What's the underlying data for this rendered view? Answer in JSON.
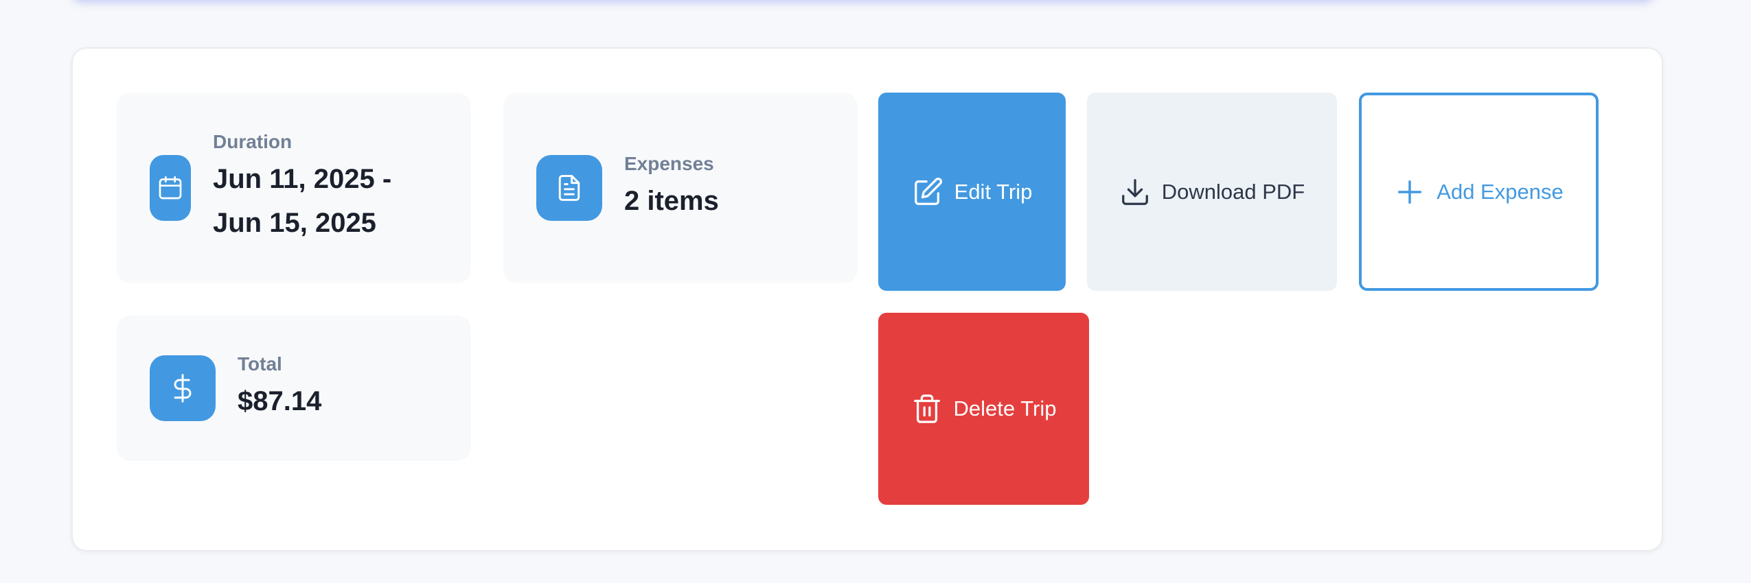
{
  "trip": {
    "duration": {
      "label": "Duration",
      "value": "Jun 11, 2025 - Jun 15, 2025",
      "icon": "calendar-icon"
    },
    "expenses": {
      "label": "Expenses",
      "value": "2 items",
      "icon": "document-icon"
    },
    "total": {
      "label": "Total",
      "value": "$87.14",
      "icon": "dollar-icon"
    }
  },
  "actions": {
    "edit": {
      "label": "Edit Trip",
      "icon": "edit-icon",
      "color": "#4299e1"
    },
    "download": {
      "label": "Download PDF",
      "icon": "download-icon",
      "color": "#edf2f7"
    },
    "add": {
      "label": "Add Expense",
      "icon": "plus-icon",
      "color": "#4299e1"
    },
    "delete": {
      "label": "Delete Trip",
      "icon": "trash-icon",
      "color": "#e53e3e"
    }
  },
  "colors": {
    "accent": "#4299e1",
    "danger": "#e53e3e",
    "card_bg": "#f8f9fb",
    "label": "#718096",
    "value": "#1a202c"
  }
}
